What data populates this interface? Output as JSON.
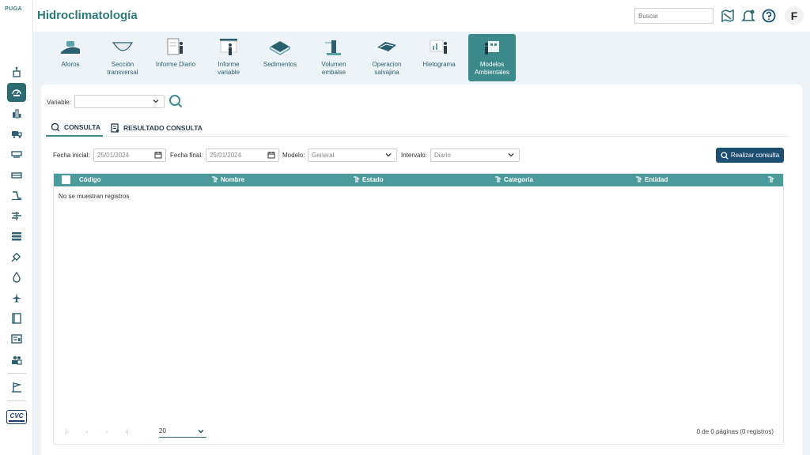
{
  "app": {
    "logo_text": "PUGA",
    "title": "Hidroclimatología"
  },
  "header": {
    "search_placeholder": "Buscar",
    "icons": [
      "map-icon",
      "bell-icon",
      "help-icon"
    ],
    "user_initial": "F"
  },
  "sidebar": {
    "items": [
      "station-icon",
      "gauge-icon",
      "chart-icon",
      "truck-icon",
      "device-icon",
      "water-icon",
      "dam-icon",
      "wind-icon",
      "layers-icon",
      "satellite-icon",
      "drop-icon",
      "plane-icon",
      "book-icon",
      "report-icon",
      "people-icon",
      "flag-icon"
    ],
    "active_index": 1,
    "bottom_logo_text": "CVC"
  },
  "toolbar": {
    "items": [
      {
        "label": "Aforos"
      },
      {
        "label": "Sección transversal"
      },
      {
        "label": "Informe Diario"
      },
      {
        "label": "Informe variable"
      },
      {
        "label": "Sedimentos"
      },
      {
        "label": "Volumen embalse"
      },
      {
        "label": "Operacion salvajina"
      },
      {
        "label": "Hietograma"
      },
      {
        "label": "Modelos Ambientales"
      }
    ],
    "active_index": 8
  },
  "form": {
    "variable_label": "Variable:",
    "variable_value": "",
    "tabs": [
      {
        "label": "CONSULTA",
        "icon": "search-icon"
      },
      {
        "label": "RESULTADO CONSULTA",
        "icon": "document-icon"
      }
    ],
    "fecha_inicial_label": "Fecha inicial:",
    "fecha_inicial_value": "25/01/2024",
    "fecha_final_label": "Fecha final:",
    "fecha_final_value": "25/01/2024",
    "modelo_label": "Modelo:",
    "modelo_value": "General",
    "intervalo_label": "Intervalo:",
    "intervalo_value": "Diario",
    "submit_label": "Realizar consulta"
  },
  "table": {
    "columns": [
      "Código",
      "Nombre",
      "Estado",
      "Categoría",
      "Entidad"
    ],
    "empty_text": "No se muestran registros",
    "page_size": "20",
    "page_info": "0 de 0 páginas (0 registros)"
  },
  "colors": {
    "primary": "#2c7a7b",
    "header_row": "#4a9b9a",
    "button": "#1d4f73"
  }
}
